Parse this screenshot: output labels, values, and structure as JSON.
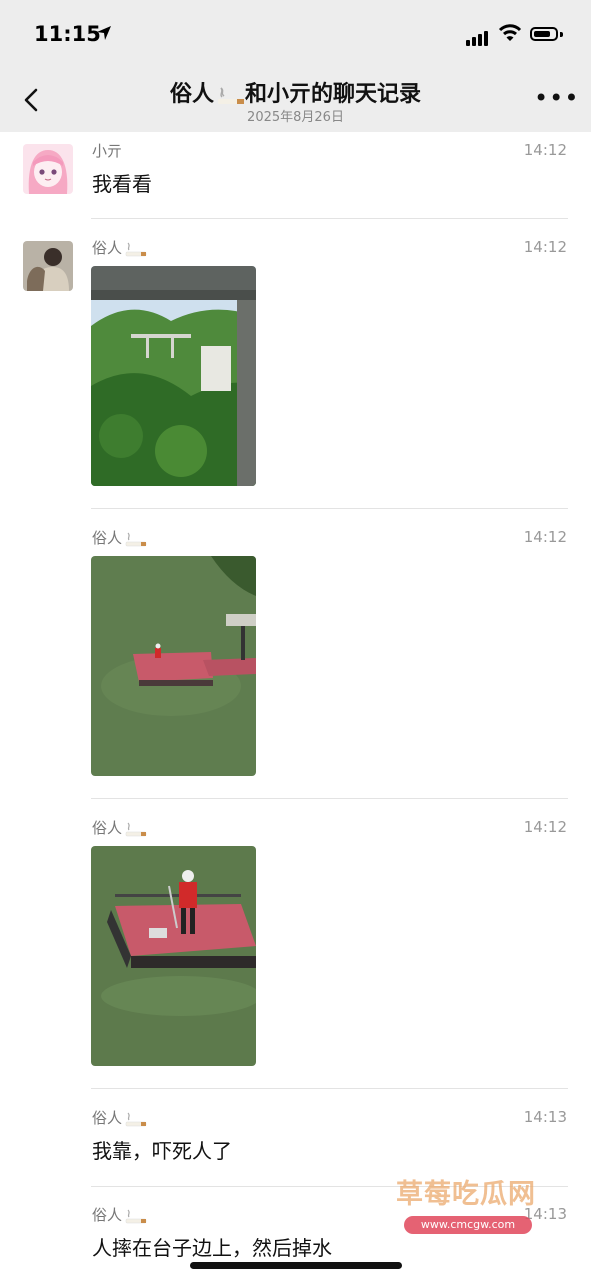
{
  "status_bar": {
    "time": "11:15",
    "location_icon": "location-arrow-icon",
    "signal_icon": "cellular-signal-icon",
    "wifi_icon": "wifi-icon",
    "battery_icon": "battery-icon",
    "battery_level": 0.8
  },
  "header": {
    "back_icon": "chevron-left-icon",
    "title_left": "俗人",
    "title_right": "和小亓的聊天记录",
    "date": "2025年8月26日",
    "more_icon": "more-dots-icon",
    "more_label": "•••"
  },
  "messages": [
    {
      "sender": "小亓",
      "time": "14:12",
      "text": "我看看"
    },
    {
      "sender": "俗人",
      "time": "14:12",
      "image": "bridge-over-green-hills-photo"
    },
    {
      "sender": "俗人",
      "time": "14:12",
      "image": "floating-red-platform-photo"
    },
    {
      "sender": "俗人",
      "time": "14:12",
      "image": "man-on-red-platform-photo"
    },
    {
      "sender": "俗人",
      "time": "14:13",
      "text": "我靠，吓死人了"
    },
    {
      "sender": "俗人",
      "time": "14:13",
      "text": "人摔在台子边上，然后掉水"
    }
  ],
  "watermark": {
    "title": "草莓吃瓜网",
    "url": "www.cmcgw.com"
  },
  "colors": {
    "bar_bg": "#ededed",
    "water": "#5f7d4f",
    "platform": "#c85a6a",
    "foliage": "#3f7a32"
  }
}
